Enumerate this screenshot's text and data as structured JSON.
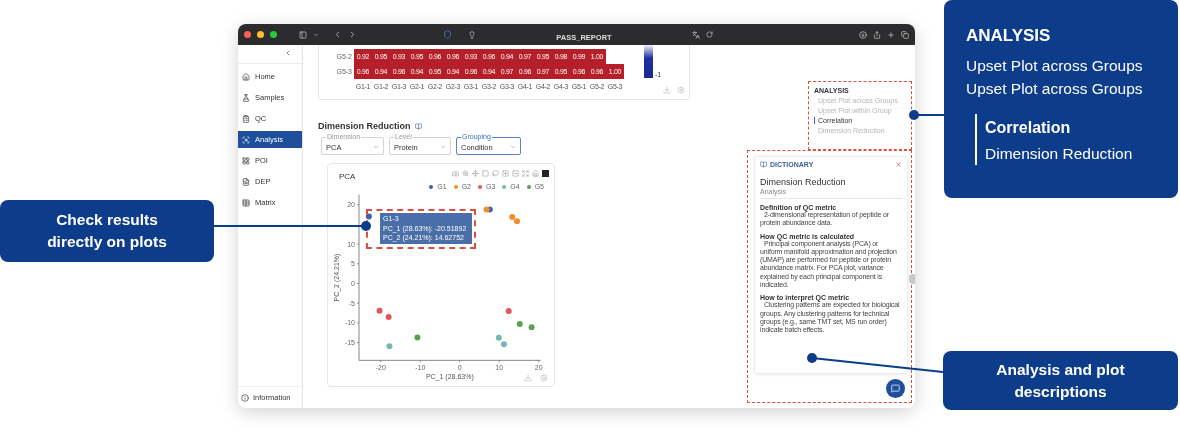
{
  "browser": {
    "title": "PASS_REPORT"
  },
  "sidebar": {
    "items": [
      {
        "label": "Home",
        "selected": false
      },
      {
        "label": "Samples",
        "selected": false
      },
      {
        "label": "QC",
        "selected": false
      },
      {
        "label": "Analysis",
        "selected": true
      },
      {
        "label": "POI",
        "selected": false
      },
      {
        "label": "DEP",
        "selected": false
      },
      {
        "label": "Matrix",
        "selected": false
      }
    ],
    "footer": {
      "label": "Information"
    }
  },
  "heatmap": {
    "rows": [
      {
        "label": "G5-2",
        "cells": [
          "0.92",
          "0.95",
          "0.93",
          "0.95",
          "0.96",
          "0.96",
          "0.93",
          "0.96",
          "0.94",
          "0.97",
          "0.95",
          "0.98",
          "0.99",
          "1.00"
        ]
      },
      {
        "label": "G5-3",
        "cells": [
          "0.96",
          "0.94",
          "0.96",
          "0.94",
          "0.95",
          "0.94",
          "0.96",
          "0.94",
          "0.97",
          "0.96",
          "0.97",
          "0.95",
          "0.96",
          "0.96",
          "1.00"
        ]
      }
    ],
    "x_labels": [
      "G1-1",
      "G1-2",
      "G1-3",
      "G2-1",
      "G2-2",
      "G2-3",
      "G3-1",
      "G3-2",
      "G3-3",
      "G4-1",
      "G4-2",
      "G4-3",
      "G5-1",
      "G5-2",
      "G5-3"
    ],
    "colorbar_label": "-1"
  },
  "dimension_reduction": {
    "title": "Dimension Reduction",
    "controls": [
      {
        "label": "Dimension",
        "value": "PCA",
        "selected": false
      },
      {
        "label": "Level",
        "value": "Protein",
        "selected": false
      },
      {
        "label": "Grouping",
        "value": "Condition",
        "selected": true
      }
    ],
    "plot": {
      "title": "PCA",
      "tooltip": {
        "title": "G1-3",
        "lines": [
          "PC_1 (28.63%): -20.51892",
          "PC_2 (24.21%): 14.62752"
        ]
      },
      "chart_data": {
        "type": "scatter",
        "xlabel": "PC_1 (28.63%)",
        "ylabel": "PC_2 (24.21%)",
        "xlim": [
          -25.5,
          20.5
        ],
        "ylim": [
          -19.5,
          22.5
        ],
        "xticks": [
          -20,
          -10,
          0,
          10,
          20
        ],
        "yticks": [
          -15,
          -10,
          -5,
          0,
          5,
          10,
          20
        ],
        "series": [
          {
            "name": "G1",
            "color": "#3d63ae",
            "x": [
              -23,
              7.6
            ],
            "values": [
              17,
              18.8
            ]
          },
          {
            "name": "G2",
            "color": "#f28e2b",
            "x": [
              6.8,
              13.3,
              14.5
            ],
            "values": [
              18.8,
              16.9,
              15.8
            ]
          },
          {
            "name": "G3",
            "color": "#e15759",
            "x": [
              -20.3,
              -18,
              12.4
            ],
            "values": [
              -6.9,
              -8.5,
              -7
            ]
          },
          {
            "name": "G4",
            "color": "#76b7b2",
            "x": [
              -17.8,
              9.9,
              11.2
            ],
            "values": [
              -15.9,
              -13.8,
              -15.4
            ]
          },
          {
            "name": "G5",
            "color": "#59a14f",
            "x": [
              -10.7,
              15.2,
              18.2
            ],
            "values": [
              -13.7,
              -10.3,
              -11.1
            ]
          }
        ]
      }
    }
  },
  "analysis_nav": {
    "title": "ANALYSIS",
    "items": [
      {
        "label": "Upset Plot across Groups",
        "selected": false
      },
      {
        "label": "Upset Plot within Group",
        "selected": false
      },
      {
        "label": "Correlation",
        "selected": true
      },
      {
        "label": "Dimension Reduction",
        "selected": false
      }
    ]
  },
  "dictionary": {
    "header": "DICTIONARY",
    "title": "Dimension Reduction",
    "subtitle": "Analysis",
    "sections": [
      {
        "heading": "Definition of QC metric",
        "body": "2-dimensional representation of peptide or protein abundance data."
      },
      {
        "heading": "How QC metric is calculated",
        "body": "Principal component analysis (PCA) or uniform manifold approximation and projection (UMAP) are performed for peptide or protein abundance matrix. For PCA plot, variance explained by each principal component is indicated."
      },
      {
        "heading": "How to interpret QC metric",
        "body": "Clustering patterns are expected for biological groups. Any clustering patterns for technical groups (e.g., same TMT set, MS run order) indicate batch effects."
      }
    ]
  },
  "callouts": [
    {
      "kind": "navigation",
      "title": "ANALYSIS",
      "items": [
        {
          "label": "Upset Plot across Groups",
          "selected": false,
          "bracketed": false
        },
        {
          "label": "Upset Plot across Groups",
          "selected": false,
          "bracketed": false
        },
        {
          "label": "Correlation",
          "selected": true,
          "bracketed": true
        },
        {
          "label": "Dimension Reduction",
          "selected": false,
          "bracketed": true
        }
      ]
    },
    {
      "kind": "plots",
      "text": "Check results directly on plots"
    },
    {
      "kind": "descriptions",
      "text": "Analysis and plot descriptions"
    }
  ]
}
